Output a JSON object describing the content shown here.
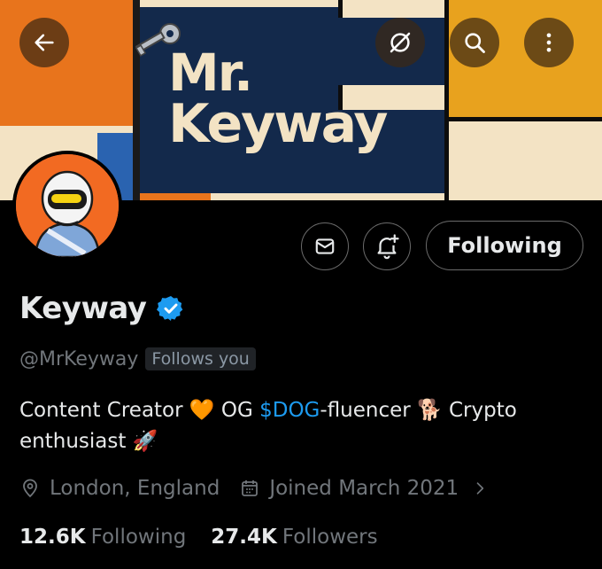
{
  "banner": {
    "title_line1": "Mr.",
    "title_line2": "Keyway"
  },
  "header_buttons": {
    "back_icon": "arrow-left-icon",
    "grok_icon": "grok-icon",
    "search_icon": "search-icon",
    "more_icon": "more-vertical-icon"
  },
  "actions": {
    "message_icon": "mail-icon",
    "notify_icon": "bell-plus-icon",
    "follow_label": "Following"
  },
  "profile": {
    "name": "Keyway",
    "verified_icon": "verified-badge-icon",
    "handle": "@MrKeyway",
    "follows_you": "Follows you",
    "bio_part1": "Content Creator",
    "bio_emoji_heart": "🧡",
    "bio_part2": " OG ",
    "bio_cashtag": "$DOG",
    "bio_part3": "-fluencer",
    "bio_emoji_dog": "🐕",
    "bio_part4": " Crypto enthusiast",
    "bio_emoji_rocket": "🚀",
    "location": "London, England",
    "joined": "Joined March 2021",
    "following_count": "12.6K",
    "following_label": "Following",
    "followers_count": "27.4K",
    "followers_label": "Followers"
  },
  "colors": {
    "background": "#000000",
    "text": "#e7e9ea",
    "muted": "#71767b",
    "link": "#1d9bf0",
    "verified": "#1d9bf0",
    "banner_orange": "#e8741c",
    "banner_navy": "#13294b",
    "banner_cream": "#f3e3c4"
  }
}
